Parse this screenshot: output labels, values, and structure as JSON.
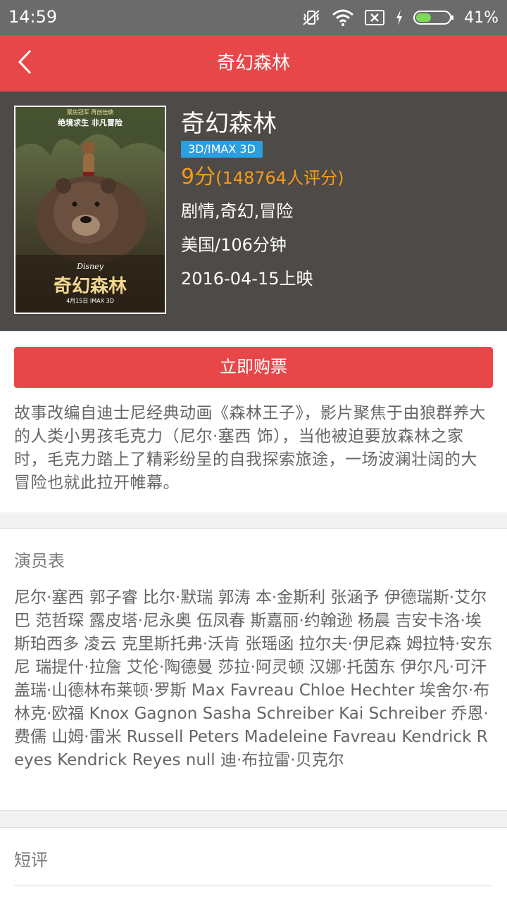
{
  "status_bar": {
    "time": "14:59",
    "battery_percent": "41%",
    "icons": [
      "vibrate-off-icon",
      "wifi-icon",
      "sim-off-icon",
      "charging-icon",
      "battery-icon"
    ]
  },
  "app_bar": {
    "title": "奇幻森林",
    "back_icon": "chevron-left-icon"
  },
  "movie": {
    "name": "奇幻森林",
    "format": "3D/IMAX 3D",
    "score": "9分",
    "rating_count": "(148764人评分)",
    "genres": "剧情,奇幻,冒险",
    "country_duration": "美国/106分钟",
    "release": "2016-04-15上映",
    "poster": {
      "tagline_top": "票房冠军 再创佳绩",
      "tagline_main": "绝境求生 非凡冒险",
      "title": "奇幻森林",
      "studio": "Disney",
      "date_line": "4月15日 IMAX 3D"
    }
  },
  "actions": {
    "buy_label": "立即购票"
  },
  "synopsis": "故事改编自迪士尼经典动画《森林王子》，影片聚焦于由狼群养大的人类小男孩毛克力（尼尔·塞西 饰），当他被迫要放森林之家时，毛克力踏上了精彩纷呈的自我探索旅途，一场波澜壮阔的大冒险也就此拉开帷幕。",
  "cast": {
    "title": "演员表",
    "list": "尼尔·塞西 郭子睿 比尔·默瑞 郭涛 本·金斯利 张涵予 伊德瑞斯·艾尔巴 范哲琛 露皮塔·尼永奥 伍凤春 斯嘉丽·约翰逊 杨晨 吉安卡洛·埃斯珀西多 凌云 克里斯托弗·沃肯 张瑶函 拉尔夫·伊尼森 姆拉特·安东尼 瑞提什·拉詹 艾伦·陶德曼 莎拉·阿灵顿 汉娜·托茵东 伊尔凡·可汗 盖瑞·山德林布莱顿·罗斯 Max Favreau Chloe Hechter 埃舍尔·布林克·欧福 Knox Gagnon Sasha Schreiber Kai Schreiber 乔恩·费儒 山姆·雷米 Russell Peters Madeleine Favreau Kendrick Reyes  Kendrick Reyes  null 迪·布拉雷·贝克尔"
  },
  "reviews": {
    "title": "短评"
  },
  "colors": {
    "accent": "#e8474a",
    "header_bg": "#4d4a47",
    "badge": "#2b9fe0",
    "rating": "#f59a1b",
    "status_bar": "#6b6b6b"
  }
}
